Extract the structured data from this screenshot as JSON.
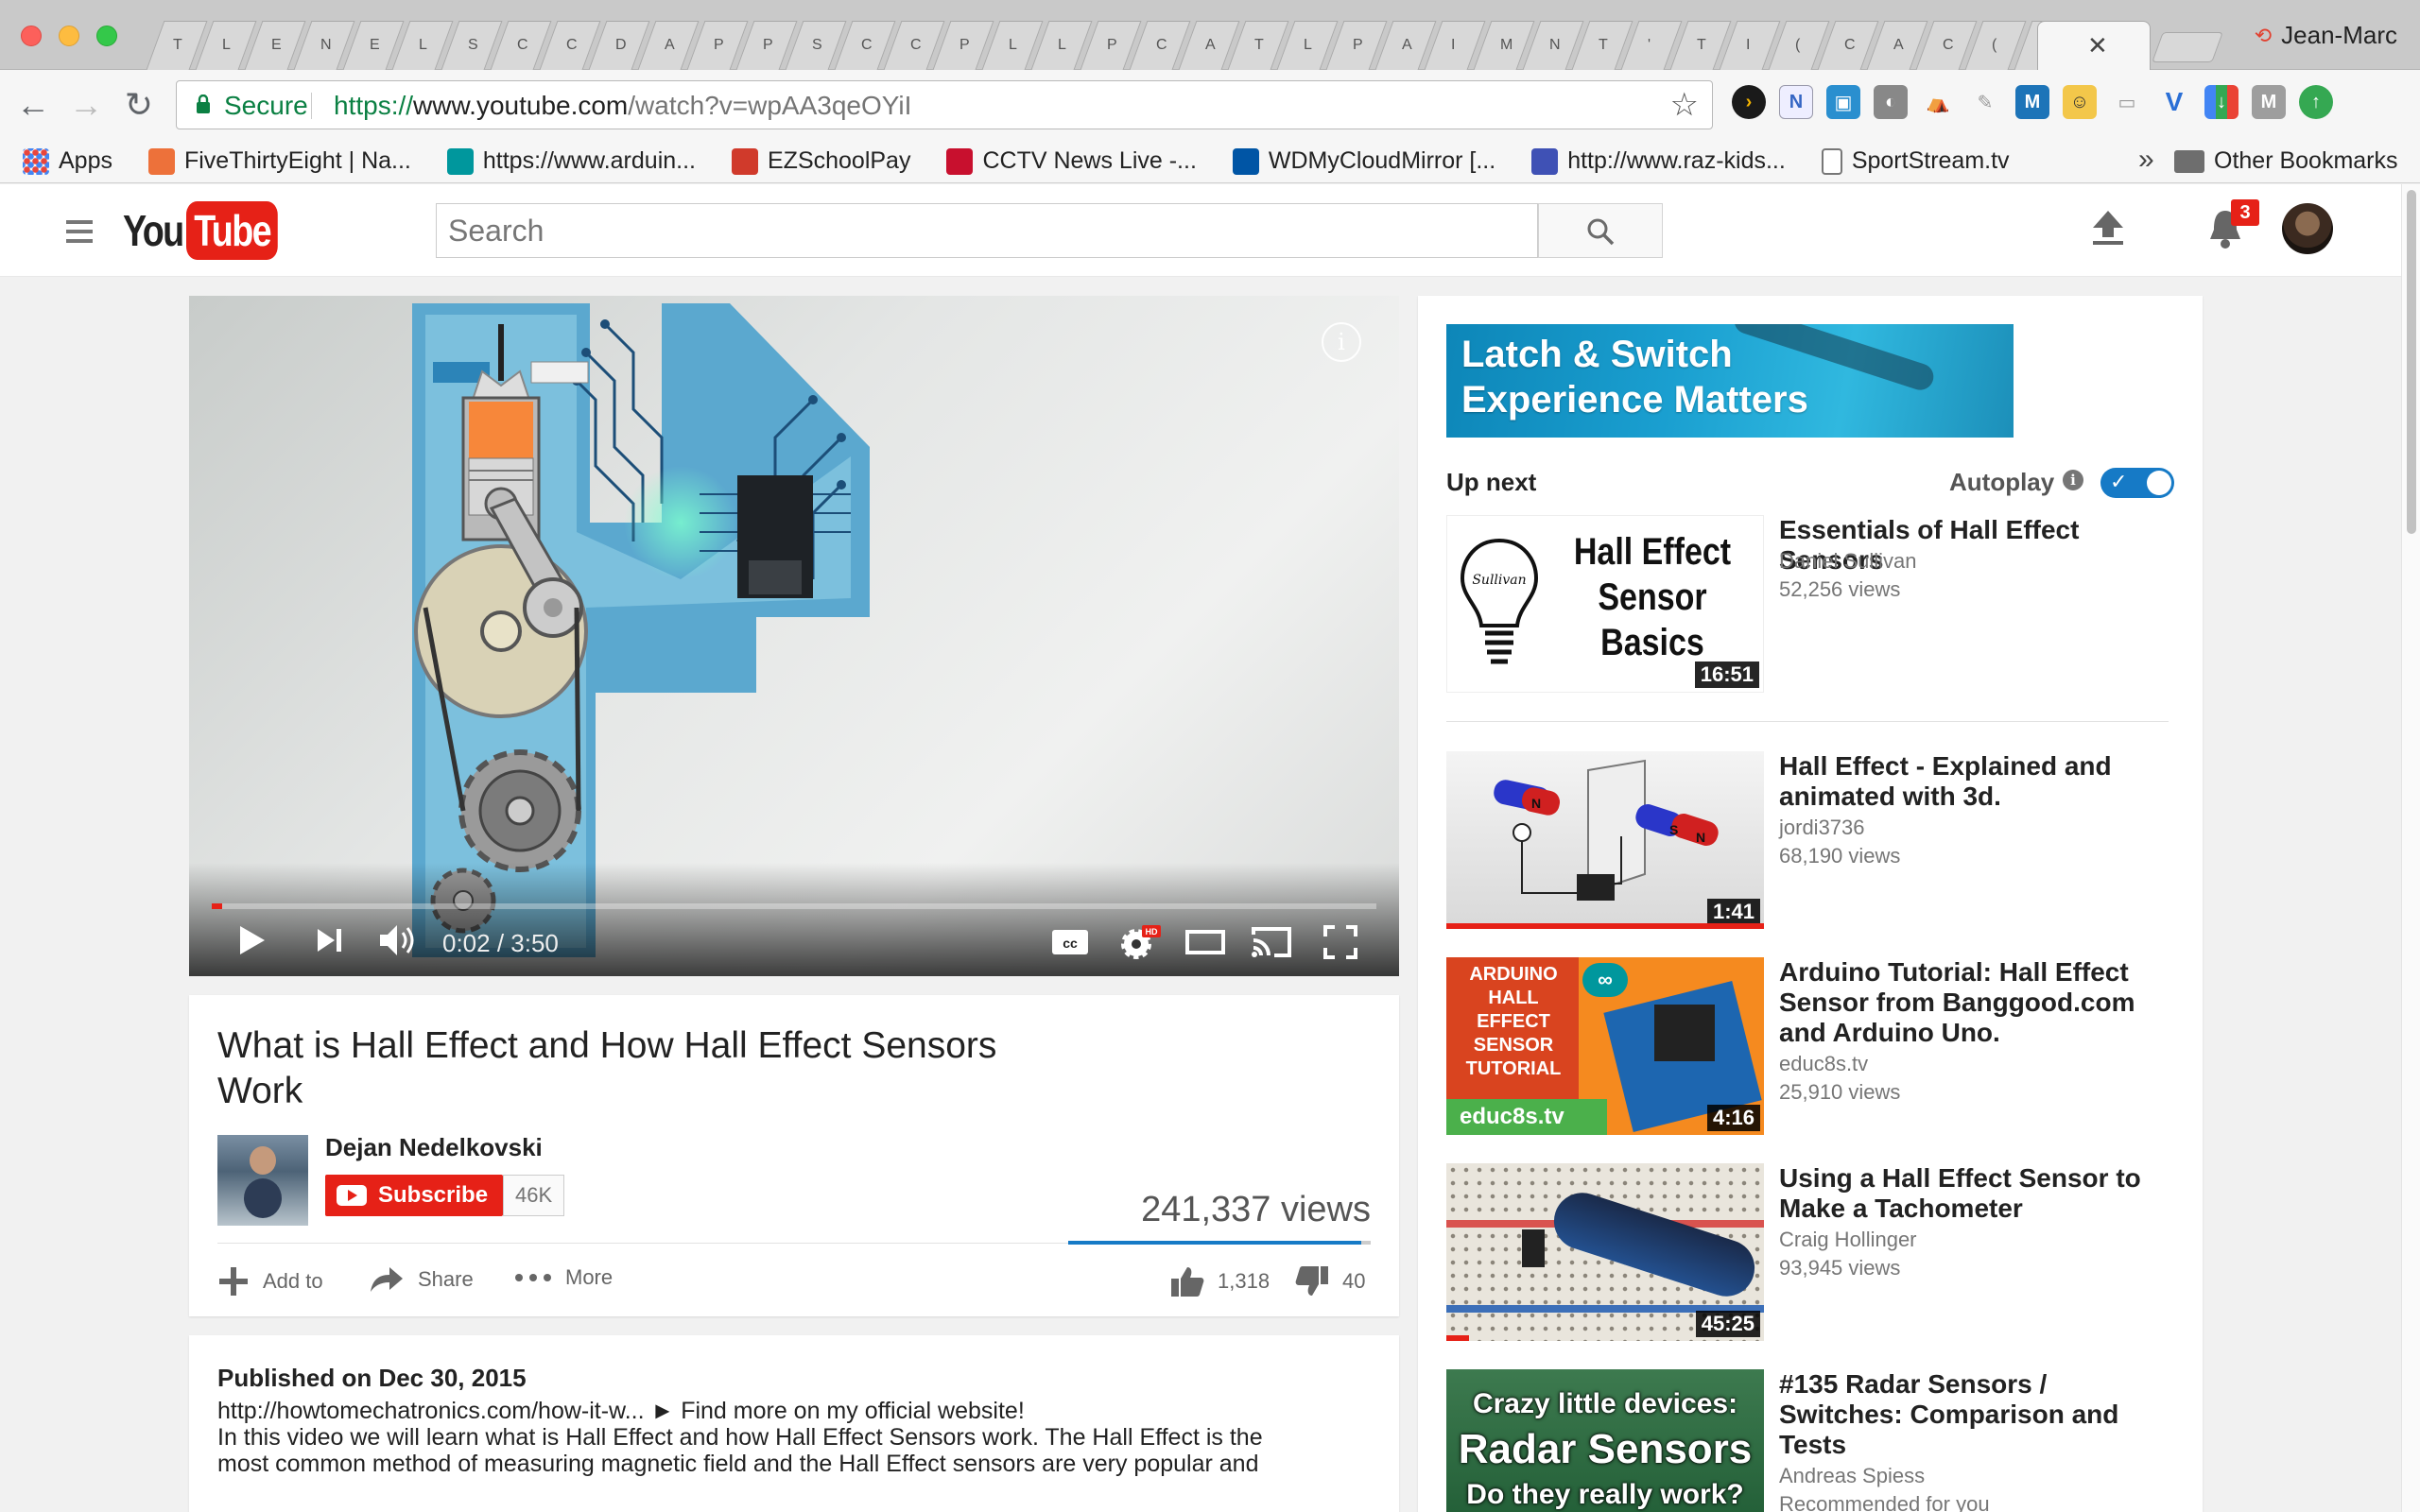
{
  "browser": {
    "tab_glyphs": [
      "T",
      "L",
      "E",
      "N",
      "E",
      "L",
      "S",
      "C",
      "C",
      "D",
      "A",
      "P",
      "P",
      "S",
      "C",
      "C",
      "P",
      "L",
      "L",
      "P",
      "C",
      "A",
      "T",
      "L",
      "P",
      "A",
      "I",
      "M",
      "N",
      "T",
      "'",
      "T",
      "I",
      "(",
      "C",
      "A",
      "C",
      "(",
      "(",
      "A"
    ],
    "active_tab_close": "✕",
    "profile_name": "Jean-Marc",
    "secure_label": "Secure",
    "url_scheme": "https://",
    "url_host": "www.youtube.com",
    "url_path": "/watch?v=wpAA3qeOYiI",
    "bookmarks": [
      {
        "label": "Apps",
        "icon": "apps-grid-icon",
        "color": "#e8453c"
      },
      {
        "label": "FiveThirtyEight | Na...",
        "icon": "fox-icon",
        "color": "#ed713a"
      },
      {
        "label": "https://www.arduin...",
        "icon": "arduino-icon",
        "color": "#00979d"
      },
      {
        "label": "EZSchoolPay",
        "icon": "ezschoolpay-icon",
        "color": "#d03a2b"
      },
      {
        "label": "CCTV News Live -...",
        "icon": "cctv-icon",
        "color": "#c8102e"
      },
      {
        "label": "WDMyCloudMirror [...",
        "icon": "wd-icon",
        "color": "#0055a5"
      },
      {
        "label": "http://www.raz-kids...",
        "icon": "razkids-icon",
        "color": "#3f51b5"
      },
      {
        "label": "SportStream.tv",
        "icon": "document-icon",
        "color": "#ffffff"
      }
    ],
    "bookmarks_more": "»",
    "other_bookmarks": "Other Bookmarks"
  },
  "youtube": {
    "search_placeholder": "Search",
    "notification_count": "3",
    "logo_you": "You",
    "logo_tube": "Tube"
  },
  "player": {
    "time_current": "0:02",
    "time_total": "3:50",
    "progress_fraction": 0.009,
    "info_glyph": "i"
  },
  "video": {
    "title": "What is Hall Effect and How Hall Effect Sensors Work",
    "channel": "Dejan Nedelkovski",
    "subscribe_label": "Subscribe",
    "subscriber_count": "46K",
    "views": "241,337 views",
    "likes": "1,318",
    "dislikes": "40",
    "like_fraction": 0.97,
    "add_to_label": "Add to",
    "share_label": "Share",
    "more_label": "More",
    "published": "Published on Dec 30, 2015",
    "description": [
      "http://howtomechatronics.com/how-it-w... ► Find more on my official website!",
      "In this video we will learn what is Hall Effect and how Hall Effect Sensors work. The Hall Effect is the",
      "most common method of measuring magnetic field and the Hall Effect sensors are very popular and"
    ]
  },
  "sidebar": {
    "ad_line1": "Latch & Switch",
    "ad_line2": "Experience Matters",
    "up_next": "Up next",
    "autoplay": "Autoplay",
    "autoplay_info_glyph": "i",
    "autoplay_on": true,
    "recommendations": [
      {
        "title": "Essentials of Hall Effect Sensors",
        "channel": "Daniel Sullivan",
        "views": "52,256 views",
        "duration": "16:51",
        "thumb_text": [
          "Hall Effect",
          "Sensor",
          "Basics"
        ],
        "thumb_brand": "Sullivan"
      },
      {
        "title": "Hall Effect - Explained and animated with 3d.",
        "channel": "jordi3736",
        "views": "68,190 views",
        "duration": "1:41",
        "watched": 1.0,
        "thumb_text": [
          "N",
          "S",
          "N"
        ]
      },
      {
        "title": "Arduino Tutorial: Hall Effect Sensor from Banggood.com and Arduino Uno.",
        "channel": "educ8s.tv",
        "views": "25,910 views",
        "duration": "4:16",
        "thumb_text": [
          "ARDUINO",
          "HALL EFFECT",
          "SENSOR",
          "TUTORIAL"
        ],
        "thumb_brand": "educ8s.tv"
      },
      {
        "title": "Using a Hall Effect Sensor to Make a Tachometer",
        "channel": "Craig Hollinger",
        "views": "93,945 views",
        "duration": "45:25",
        "watched": 0.07
      },
      {
        "title": "#135 Radar Sensors / Switches: Comparison and Tests",
        "channel": "Andreas Spiess",
        "views": "Recommended for you",
        "thumb_text": [
          "Crazy little devices:",
          "Radar Sensors",
          "Do they really work?"
        ]
      }
    ]
  }
}
